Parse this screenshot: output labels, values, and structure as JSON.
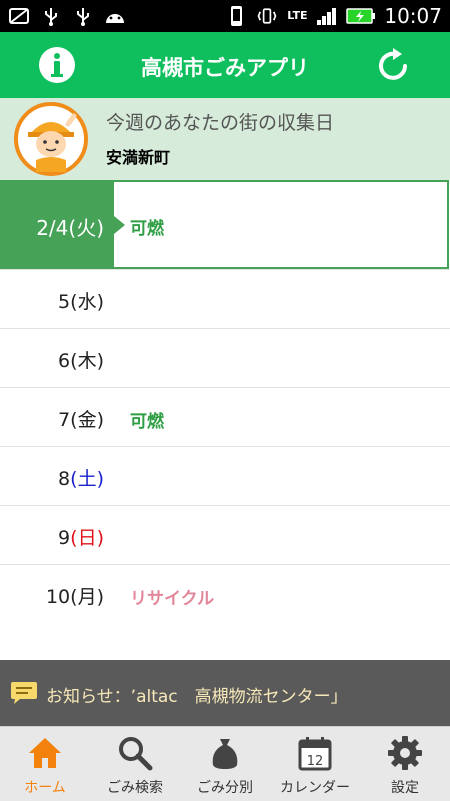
{
  "status_bar": {
    "time": "10:07",
    "network": "LTE",
    "left_icons": [
      "no-sim-icon",
      "usb-icon",
      "usb-icon",
      "android-icon"
    ],
    "right_icons": [
      "phone-vibrate-icon",
      "vibrate-icon",
      "lte-icon",
      "signal-icon",
      "battery-icon"
    ]
  },
  "header": {
    "title": "高槻市ごみアプリ",
    "left_icon": "info-icon",
    "right_icon": "refresh-icon",
    "color": "#0fbf5d"
  },
  "intro": {
    "heading": "今週のあなたの街の収集日",
    "area": "安満新町"
  },
  "schedule": {
    "today": {
      "date": "2/4(火)",
      "garbage": "可燃"
    },
    "days": [
      {
        "day": "5",
        "weekday": "水",
        "garbage": ""
      },
      {
        "day": "6",
        "weekday": "木",
        "garbage": ""
      },
      {
        "day": "7",
        "weekday": "金",
        "garbage": "可燃"
      },
      {
        "day": "8",
        "weekday": "土",
        "garbage": ""
      },
      {
        "day": "9",
        "weekday": "日",
        "garbage": ""
      },
      {
        "day": "10",
        "weekday": "月",
        "garbage": "リサイクル"
      }
    ]
  },
  "notice": {
    "text": "お知らせ：ʼaltac　高槻物流センター」"
  },
  "bottom_nav": {
    "items": [
      {
        "label": "ホーム",
        "icon": "home-icon",
        "active": true
      },
      {
        "label": "ごみ検索",
        "icon": "search-icon",
        "active": false
      },
      {
        "label": "ごみ分別",
        "icon": "garbage-bag-icon",
        "active": false
      },
      {
        "label": "カレンダー",
        "icon": "calendar-icon",
        "active": false
      },
      {
        "label": "設定",
        "icon": "gear-icon",
        "active": false
      }
    ],
    "calendar_day": "12"
  },
  "colors": {
    "accent_green": "#45a257",
    "burnable": "#2f9e45",
    "recycle": "#e2879a",
    "saturday": "#1a22c9",
    "sunday": "#e0121b",
    "active_nav": "#f2820c"
  }
}
